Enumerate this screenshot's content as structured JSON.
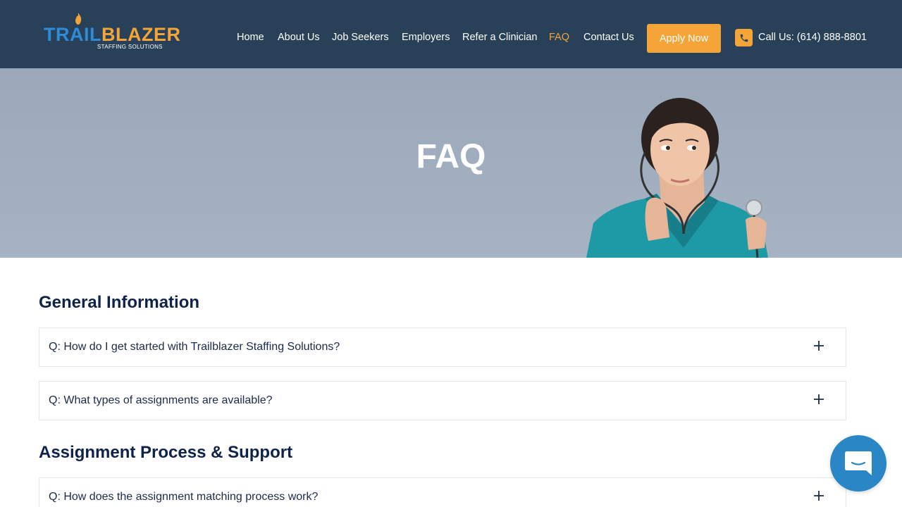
{
  "header": {
    "logo": {
      "word_a": "TRAIL",
      "word_b": "BLAZER",
      "sub": "STAFFING SOLUTIONS"
    },
    "nav": [
      {
        "label": "Home",
        "active": false
      },
      {
        "label": "About Us",
        "active": false
      },
      {
        "label": "Job Seekers",
        "active": false
      },
      {
        "label": "Employers",
        "active": false
      },
      {
        "label": "Refer a Clinician",
        "active": false
      },
      {
        "label": "FAQ",
        "active": true
      },
      {
        "label": "Contact Us",
        "active": false
      }
    ],
    "apply_label": "Apply Now",
    "phone_label": "Call Us: (614) 888-8801",
    "phone_icon": "phone-icon"
  },
  "hero": {
    "title": "FAQ"
  },
  "sections": [
    {
      "title": "General Information",
      "questions": [
        "Q: How do I get started with Trailblazer Staffing Solutions?",
        "Q: What types of assignments are available?"
      ]
    },
    {
      "title": "Assignment Process & Support",
      "questions": [
        "Q: How does the assignment matching process work?"
      ]
    }
  ],
  "colors": {
    "header_bg": "#284159",
    "accent": "#f5a437",
    "brand_blue": "#2f8bd6",
    "heading": "#0f2247",
    "chat": "#2b86c5"
  },
  "chat": {
    "icon": "chat-bubble-icon"
  }
}
